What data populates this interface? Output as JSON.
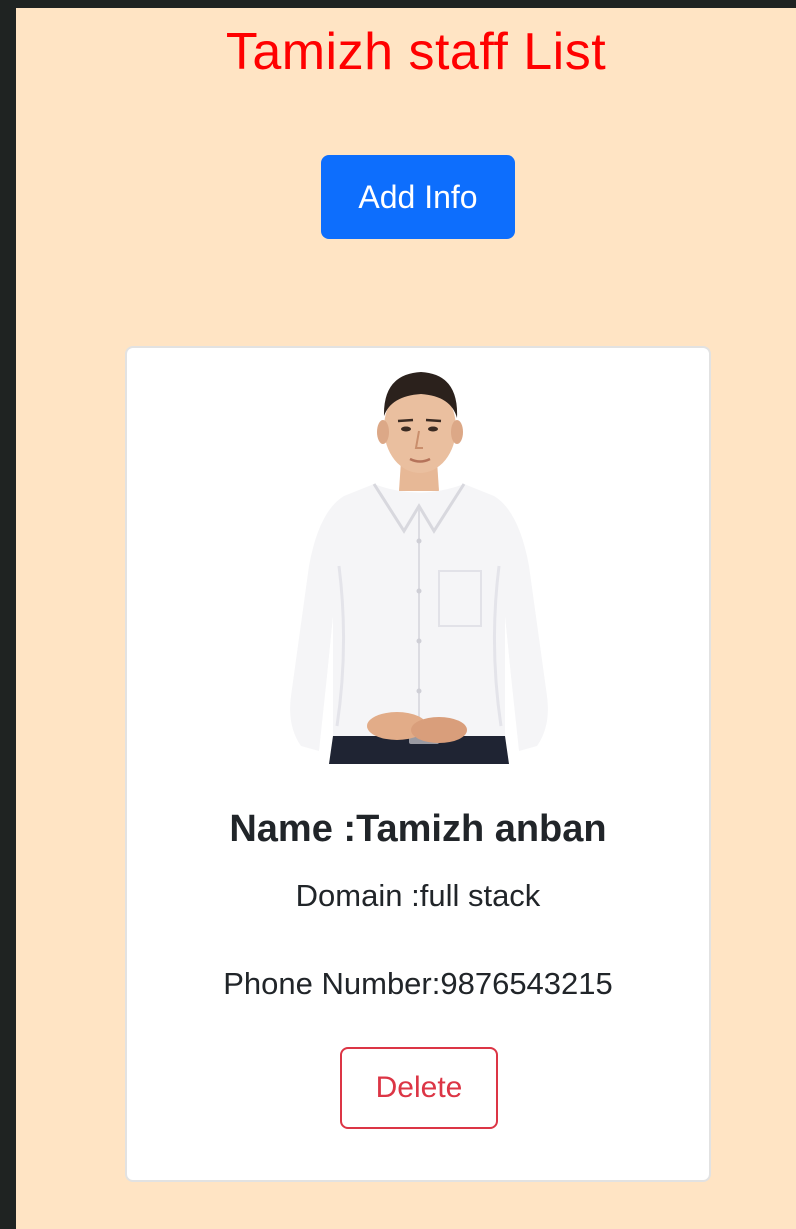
{
  "page": {
    "title": "Tamizh staff List",
    "title_color": "#ff0000",
    "background": "#ffe4c4"
  },
  "toolbar": {
    "add_label": "Add Info",
    "add_color": "#0d6efd"
  },
  "staff": [
    {
      "photo_icon": "person-photo",
      "name": "Name :Tamizh anban",
      "domain": "Domain :full stack",
      "phone": "Phone Number:9876543215",
      "delete_label": "Delete",
      "delete_color": "#dc3545"
    }
  ]
}
